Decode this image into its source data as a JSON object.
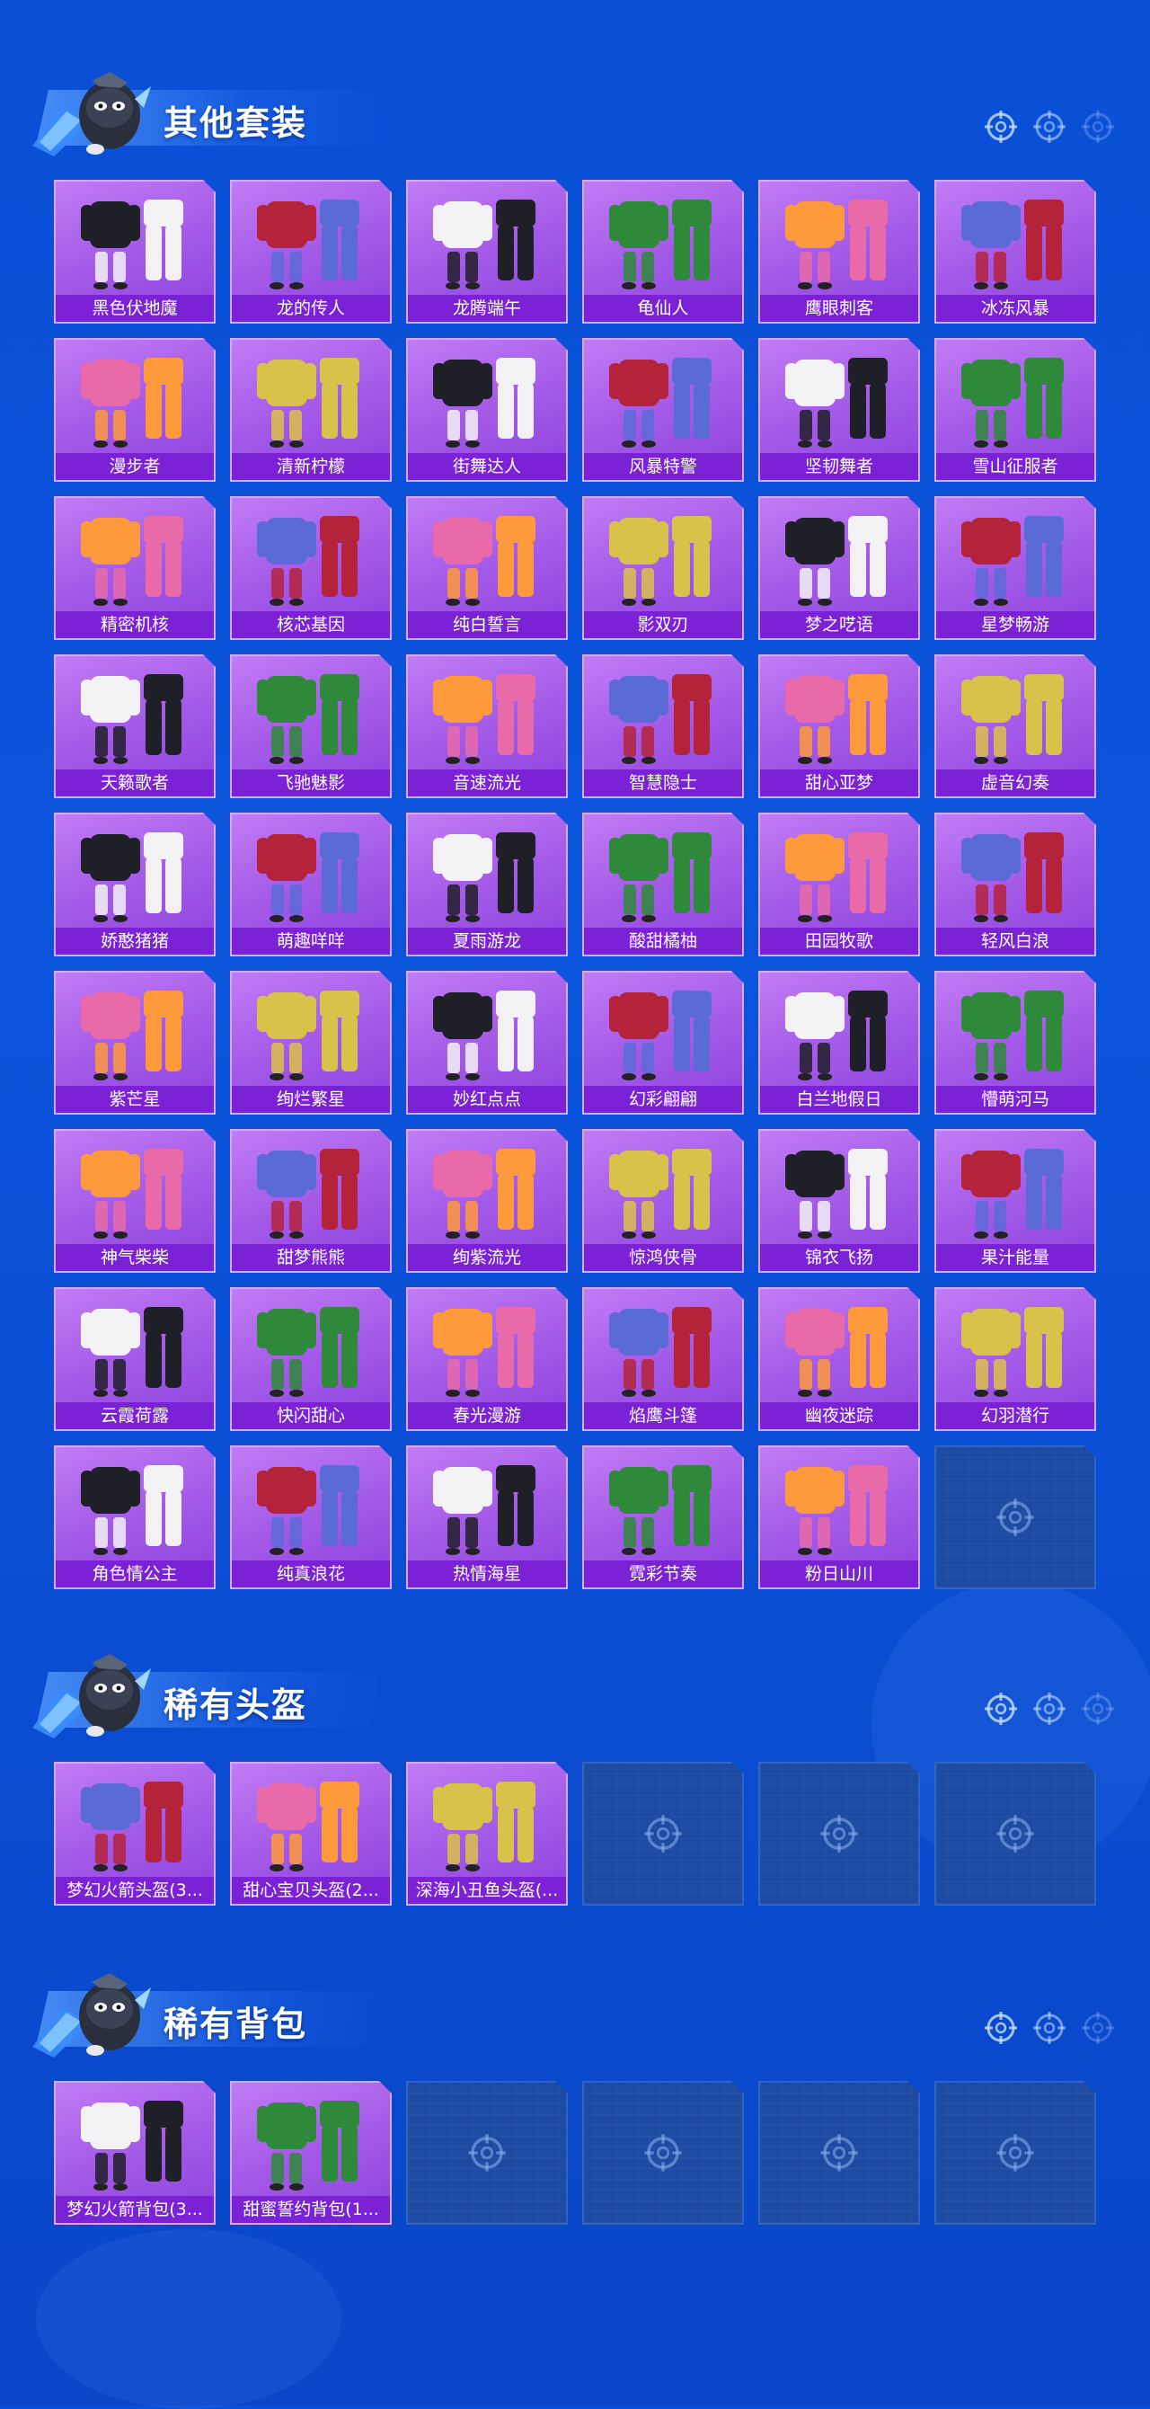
{
  "colors": {
    "page_bg": "#0b55dc",
    "card_bg": "#a45ae8",
    "label_bg": "#7b22d6",
    "empty_bg": "#1d4aa2",
    "title_text": "#ffffff"
  },
  "sections": [
    {
      "id": "suits",
      "title": "其他套装",
      "icon": "mascot-icon",
      "items": [
        "黑色伏地魔",
        "龙的传人",
        "龙腾端午",
        "龟仙人",
        "鹰眼刺客",
        "冰冻风暴",
        "漫步者",
        "清新柠檬",
        "街舞达人",
        "风暴特警",
        "坚韧舞者",
        "雪山征服者",
        "精密机核",
        "核芯基因",
        "纯白誓言",
        "影双刃",
        "梦之呓语",
        "星梦畅游",
        "天籁歌者",
        "飞驰魅影",
        "音速流光",
        "智慧隐士",
        "甜心亚梦",
        "虚音幻奏",
        "娇憨猪猪",
        "萌趣咩咩",
        "夏雨游龙",
        "酸甜橘柚",
        "田园牧歌",
        "轻风白浪",
        "紫芒星",
        "绚烂繁星",
        "妙红点点",
        "幻彩翩翩",
        "白兰地假日",
        "懵萌河马",
        "神气柴柴",
        "甜梦熊熊",
        "绚紫流光",
        "惊鸿侠骨",
        "锦衣飞扬",
        "果汁能量",
        "云霞荷露",
        "快闪甜心",
        "春光漫游",
        "焰鹰斗篷",
        "幽夜迷踪",
        "幻羽潜行",
        "角色情公主",
        "纯真浪花",
        "热情海星",
        "霓彩节奏",
        "粉日山川"
      ],
      "empty_slots": 1
    },
    {
      "id": "helmets",
      "title": "稀有头盔",
      "icon": "mascot-icon",
      "items": [
        "梦幻火箭头盔(3...",
        "甜心宝贝头盔(2...",
        "深海小丑鱼头盔(..."
      ],
      "empty_slots": 3
    },
    {
      "id": "backpacks",
      "title": "稀有背包",
      "icon": "mascot-icon",
      "items": [
        "梦幻火箭背包(3...",
        "甜蜜誓约背包(1..."
      ],
      "empty_slots": 4
    }
  ]
}
